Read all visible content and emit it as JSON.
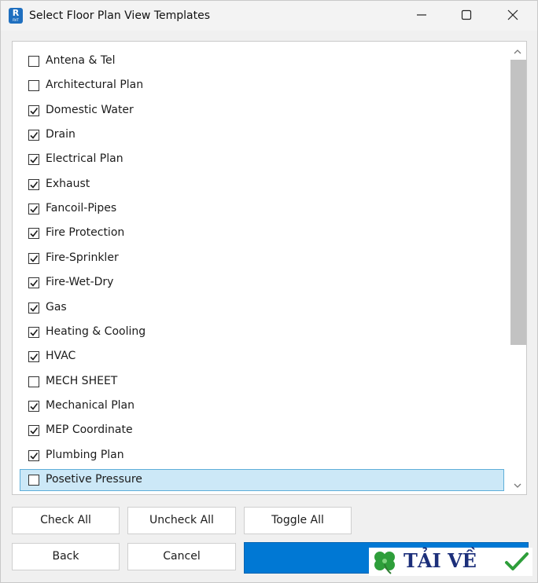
{
  "window": {
    "title": "Select Floor Plan View Templates",
    "app_icon": {
      "letter": "R",
      "sub": "RVT"
    }
  },
  "list": {
    "items": [
      {
        "label": "Antena & Tel",
        "checked": false
      },
      {
        "label": "Architectural Plan",
        "checked": false
      },
      {
        "label": "Domestic Water",
        "checked": true
      },
      {
        "label": "Drain",
        "checked": true
      },
      {
        "label": "Electrical Plan",
        "checked": true
      },
      {
        "label": "Exhaust",
        "checked": true
      },
      {
        "label": "Fancoil-Pipes",
        "checked": true
      },
      {
        "label": "Fire Protection",
        "checked": true
      },
      {
        "label": "Fire-Sprinkler",
        "checked": true
      },
      {
        "label": "Fire-Wet-Dry",
        "checked": true
      },
      {
        "label": "Gas",
        "checked": true
      },
      {
        "label": "Heating & Cooling",
        "checked": true
      },
      {
        "label": "HVAC",
        "checked": true
      },
      {
        "label": "MECH SHEET",
        "checked": false
      },
      {
        "label": "Mechanical Plan",
        "checked": true
      },
      {
        "label": "MEP Coordinate",
        "checked": true
      },
      {
        "label": "Plumbing Plan",
        "checked": true
      },
      {
        "label": "Posetive Pressure",
        "checked": false,
        "selected": true
      }
    ]
  },
  "buttons": {
    "check_all": "Check All",
    "uncheck_all": "Uncheck All",
    "toggle_all": "Toggle All",
    "back": "Back",
    "cancel": "Cancel"
  },
  "watermark": {
    "text": "TẢI VỀ"
  },
  "colors": {
    "primary": "#0078d4",
    "selection_bg": "#cce8f7",
    "selection_border": "#5eaed9",
    "watermark_text": "#1c2f7a",
    "watermark_clover": "#2e9e3a"
  }
}
